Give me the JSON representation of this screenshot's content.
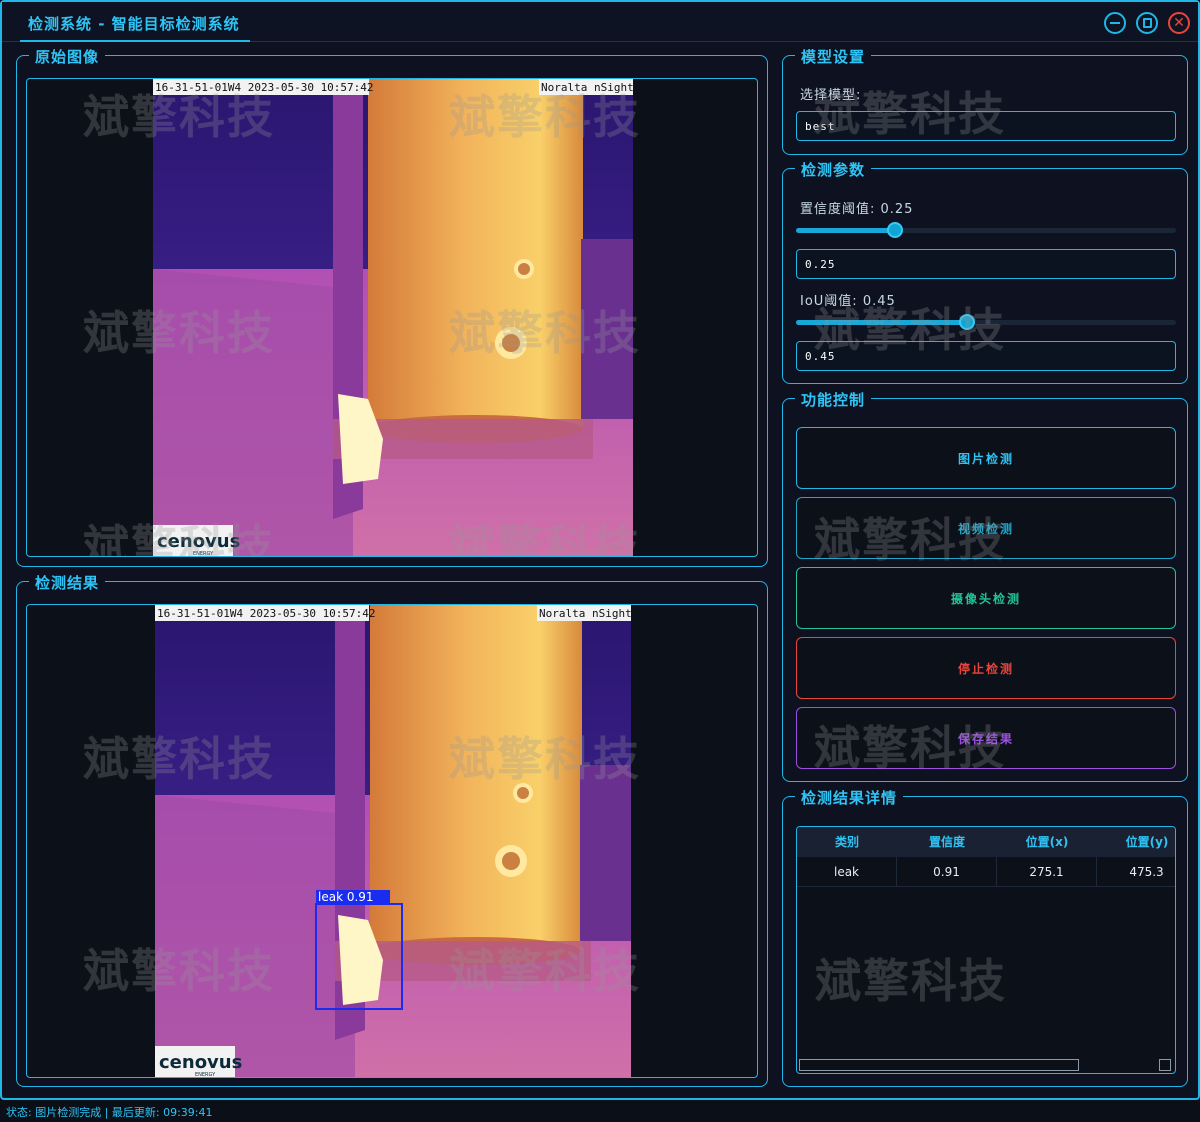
{
  "window": {
    "title": "检测系统 - 智能目标检测系统"
  },
  "panels": {
    "original_title": "原始图像",
    "result_title": "检测结果"
  },
  "image": {
    "camera_id_timestamp": "16-31-51-01W4 2023-05-30 10:57:42",
    "camera_brand": "Noralta nSight",
    "logo": "cenovus",
    "logo_sub": "ENERGY"
  },
  "detection_box": {
    "label": "leak 0.91"
  },
  "watermark": "斌擎科技",
  "model": {
    "section_title": "模型设置",
    "select_label": "选择模型:",
    "selected_value": "best"
  },
  "params": {
    "section_title": "检测参数",
    "conf_label": "置信度阈值: 0.25",
    "conf_value": "0.25",
    "conf_level": 0.25,
    "iou_label": "IoU阈值: 0.45",
    "iou_value": "0.45",
    "iou_level": 0.45
  },
  "controls": {
    "section_title": "功能控制",
    "image_detect": "图片检测",
    "video_detect": "视频检测",
    "camera_detect": "摄像头检测",
    "stop_detect": "停止检测",
    "save_result": "保存结果"
  },
  "results": {
    "section_title": "检测结果详情",
    "columns": [
      "类别",
      "置信度",
      "位置(x)",
      "位置(y)"
    ],
    "rows": [
      [
        "leak",
        "0.91",
        "275.1",
        "475.3"
      ]
    ]
  },
  "status": {
    "text": "状态: 图片检测完成 | 最后更新: 09:39:41"
  },
  "colors": {
    "accent": "#1fb6e8",
    "video_btn": "#1fa5c8",
    "camera_btn": "#22c39a",
    "stop_btn": "#e8453c",
    "save_btn": "#9b4fe0"
  }
}
